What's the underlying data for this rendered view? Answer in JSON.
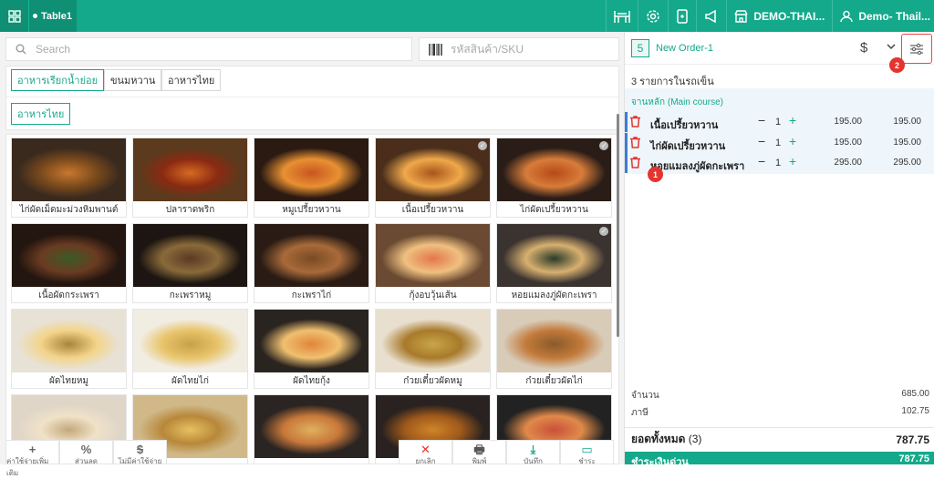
{
  "topbar": {
    "tab_label": "Table1",
    "store": "DEMO-THAI...",
    "user": "Demo- Thail..."
  },
  "search": {
    "placeholder": "Search"
  },
  "sku": {
    "placeholder": "รหัสสินค้า/SKU"
  },
  "categories": [
    {
      "label": "อาหารเรียกน้ำย่อย",
      "active": true
    },
    {
      "label": "ขนมหวาน",
      "active": false
    },
    {
      "label": "อาหารไทย",
      "active": false
    },
    {
      "label": "อาหารไทย",
      "active": true
    }
  ],
  "products": [
    {
      "label": "ไก่ผัดเม็ดมะม่วงหิมพานต์",
      "checked": false
    },
    {
      "label": "ปลาราดพริก",
      "checked": false
    },
    {
      "label": "หมูเปรี้ยวหวาน",
      "checked": false
    },
    {
      "label": "เนื้อเปรี้ยวหวาน",
      "checked": true
    },
    {
      "label": "ไก่ผัดเปรี้ยวหวาน",
      "checked": true
    },
    {
      "label": "เนื้อผัดกระเพรา",
      "checked": false
    },
    {
      "label": "กะเพราหมู",
      "checked": false
    },
    {
      "label": "กะเพราไก่",
      "checked": false
    },
    {
      "label": "กุ้งอบวุ้นเส้น",
      "checked": false
    },
    {
      "label": "หอยแมลงภู่ผัดกะเพรา",
      "checked": true
    },
    {
      "label": "ผัดไทยหมู",
      "checked": false
    },
    {
      "label": "ผัดไทยไก่",
      "checked": false
    },
    {
      "label": "ผัดไทยกุ้ง",
      "checked": false
    },
    {
      "label": "ก๋วยเตี๋ยวผัดหมู",
      "checked": false
    },
    {
      "label": "ก๋วยเตี๋ยวผัดไก่",
      "checked": false
    },
    {
      "label": "",
      "checked": false
    },
    {
      "label": "",
      "checked": false
    },
    {
      "label": "",
      "checked": false
    },
    {
      "label": "",
      "checked": false
    },
    {
      "label": "",
      "checked": false
    }
  ],
  "bottom_actions": [
    {
      "icon": "+",
      "label": "ค่าใช้จ่ายเพิ่มเติม"
    },
    {
      "icon": "%",
      "label": "ส่วนลด"
    },
    {
      "icon": "$",
      "label": "ไม่มีค่าใช้จ่าย"
    }
  ],
  "bottom_right_actions": [
    {
      "icon": "✕",
      "label": "ยกเลิก",
      "color": "#e3342f"
    },
    {
      "icon": "🖶",
      "label": "พิมพ์",
      "color": "#555555"
    },
    {
      "icon": "⤓",
      "label": "บันทึก",
      "color": "#14a98b"
    },
    {
      "icon": "▭",
      "label": "ชำระ",
      "color": "#14a98b"
    }
  ],
  "order": {
    "number": "5",
    "name": "New Order-1",
    "currency": "$",
    "cart_count": "3 รายการในรถเข็น",
    "section_title": "จานหลัก (Main course)",
    "items": [
      {
        "name": "เนื้อเปรี้ยวหวาน",
        "qty": "1",
        "price": "195.00",
        "total": "195.00"
      },
      {
        "name": "ไก่ผัดเปรี้ยวหวาน",
        "qty": "1",
        "price": "195.00",
        "total": "195.00"
      },
      {
        "name": "หอยแมลงภู่ผัดกะเพรา",
        "qty": "1",
        "price": "295.00",
        "total": "295.00"
      }
    ],
    "subtotal_label": "จำนวน",
    "subtotal": "685.00",
    "tax_label": "ภาษี",
    "tax": "102.75",
    "grand_label": "ยอดทั้งหมด",
    "grand_count": "(3)",
    "grand_total": "787.75",
    "pay_label": "ชำระเงินด่วน",
    "pay_total": "787.75"
  },
  "markers": [
    "1",
    "2"
  ],
  "colors": {
    "accent": "#14a98b",
    "danger": "#e3342f",
    "selected_bar": "#3b7dd8"
  }
}
